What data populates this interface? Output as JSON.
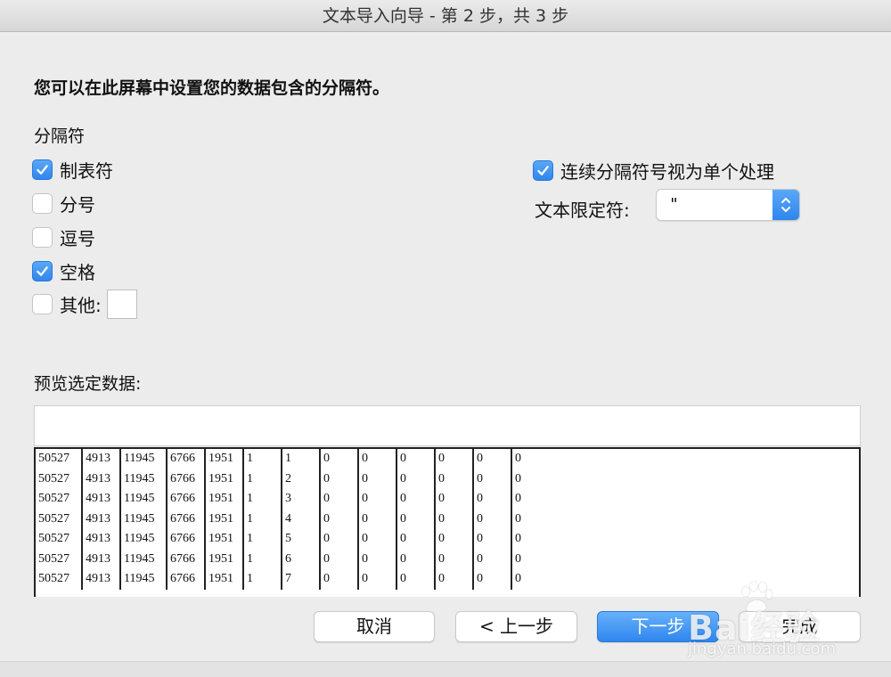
{
  "window": {
    "title": "文本导入向导 - 第 2 步，共 3 步"
  },
  "instruction": "您可以在此屏幕中设置您的数据包含的分隔符。",
  "delimiters": {
    "group_label": "分隔符",
    "tab": {
      "label": "制表符",
      "checked": true
    },
    "semicolon": {
      "label": "分号",
      "checked": false
    },
    "comma": {
      "label": "逗号",
      "checked": false
    },
    "space": {
      "label": "空格",
      "checked": true
    },
    "other": {
      "label": "其他:",
      "checked": false,
      "value": ""
    }
  },
  "consecutive": {
    "label": "连续分隔符号视为单个处理",
    "checked": true
  },
  "text_qualifier": {
    "label": "文本限定符:",
    "value": "\""
  },
  "preview": {
    "label": "预览选定数据:",
    "rows": [
      [
        "50527",
        "4913",
        "11945",
        "6766",
        "1951",
        "1",
        "1",
        "0",
        "0",
        "0",
        "0",
        "0",
        "0"
      ],
      [
        "50527",
        "4913",
        "11945",
        "6766",
        "1951",
        "1",
        "2",
        "0",
        "0",
        "0",
        "0",
        "0",
        "0"
      ],
      [
        "50527",
        "4913",
        "11945",
        "6766",
        "1951",
        "1",
        "3",
        "0",
        "0",
        "0",
        "0",
        "0",
        "0"
      ],
      [
        "50527",
        "4913",
        "11945",
        "6766",
        "1951",
        "1",
        "4",
        "0",
        "0",
        "0",
        "0",
        "0",
        "0"
      ],
      [
        "50527",
        "4913",
        "11945",
        "6766",
        "1951",
        "1",
        "5",
        "0",
        "0",
        "0",
        "0",
        "0",
        "0"
      ],
      [
        "50527",
        "4913",
        "11945",
        "6766",
        "1951",
        "1",
        "6",
        "0",
        "0",
        "0",
        "0",
        "0",
        "0"
      ],
      [
        "50527",
        "4913",
        "11945",
        "6766",
        "1951",
        "1",
        "7",
        "0",
        "0",
        "0",
        "0",
        "0",
        "0"
      ]
    ]
  },
  "buttons": {
    "cancel": "取消",
    "back": "< 上一步",
    "next": "下一步",
    "finish": "完成"
  },
  "watermark": {
    "logo": "Bai经验",
    "url": "jingyan.baidu.com"
  },
  "colors": {
    "accent": "#2f86ee",
    "window_bg": "#ececec"
  }
}
